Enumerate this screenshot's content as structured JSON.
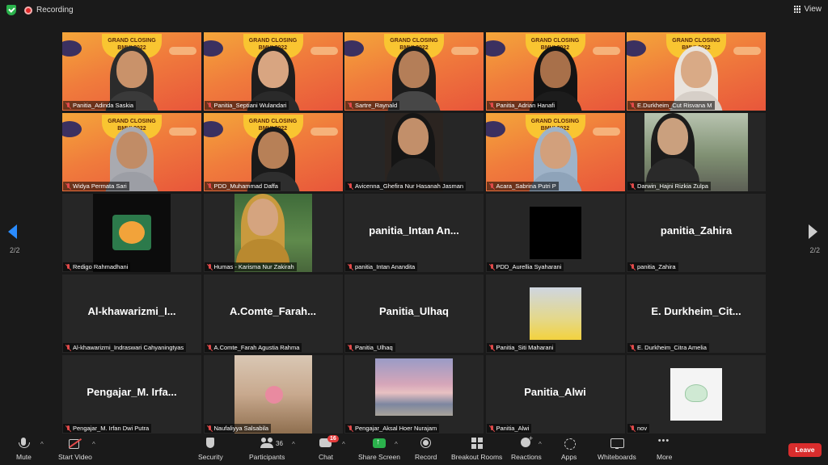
{
  "topbar": {
    "recording_label": "Recording",
    "view_label": "View"
  },
  "pagination": {
    "left": "2/2",
    "right": "2/2"
  },
  "participants": [
    {
      "name": "Panitia_Adinda Saskia",
      "display": "",
      "type": "video",
      "skin": "#c9926a",
      "hijab": "#2b2b2b",
      "body": "#3a3a3a"
    },
    {
      "name": "Panitia_Septiani Wulandari",
      "display": "",
      "type": "video",
      "skin": "#d8a581",
      "hijab": "#1e1e1e",
      "body": "#2a2a2a"
    },
    {
      "name": "Sartre_Raynald",
      "display": "",
      "type": "video",
      "skin": "#b47e58",
      "hijab": "#1b1b1b",
      "body": "#474747"
    },
    {
      "name": "Panitia_Adrian Hanafi",
      "display": "",
      "type": "video",
      "skin": "#a8704a",
      "hijab": "#141414",
      "body": "#1c1c1c"
    },
    {
      "name": "E.Durkheim_Cut Risvana M",
      "display": "",
      "type": "video",
      "skin": "#d9aa86",
      "hijab": "#e9e4de",
      "body": "#d6cfc8"
    },
    {
      "name": "Widya Permata Sari",
      "display": "",
      "type": "video",
      "skin": "#c18c66",
      "hijab": "#a9aab0",
      "body": "#9c9ea5"
    },
    {
      "name": "PDD_Muhammad Daffa",
      "display": "",
      "type": "video",
      "skin": "#b78057",
      "hijab": "#1a1a1a",
      "body": "#2e2e2e"
    },
    {
      "name": "Avicenna_Ghefira Nur Hasanah Jasman",
      "display": "",
      "type": "cam-dark",
      "skin": "#c28f6a",
      "hijab": "#151515",
      "body": "#222"
    },
    {
      "name": "Acara_Sabrina Putri P",
      "display": "",
      "type": "video",
      "skin": "#d2a07c",
      "hijab": "#9fb3c8",
      "body": "#8ea3b9"
    },
    {
      "name": "Darwin_Hajni Rizkia Zulpa",
      "display": "",
      "type": "cam-outdoor",
      "skin": "#caa07e",
      "hijab": "#1c1c1c",
      "body": "#2a2a2a"
    },
    {
      "name": "Redigo Rahmadhani",
      "display": "",
      "type": "image-tiger",
      "skin": "",
      "hijab": "",
      "body": ""
    },
    {
      "name": "Humas - Karisma Nur Zakirah",
      "display": "",
      "type": "image-photo",
      "skin": "#d5a47f",
      "hijab": "#c99a3e",
      "body": "#b9892f"
    },
    {
      "name": "panitia_Intan Anandita",
      "display": "panitia_Intan  An...",
      "type": "text",
      "skin": "",
      "hijab": "",
      "body": ""
    },
    {
      "name": "PDD_Aurellia Syaharani",
      "display": "",
      "type": "image-black",
      "skin": "",
      "hijab": "",
      "body": ""
    },
    {
      "name": "panitia_Zahira",
      "display": "panitia_Zahira",
      "type": "text",
      "skin": "",
      "hijab": "",
      "body": ""
    },
    {
      "name": "Al-khawarizmi_Indraswari Cahyaningtyas",
      "display": "Al-khawarizmi_I...",
      "type": "text",
      "skin": "",
      "hijab": "",
      "body": ""
    },
    {
      "name": "A.Comte_Farah Agustia Rahma",
      "display": "A.Comte_Farah...",
      "type": "text",
      "skin": "",
      "hijab": "",
      "body": ""
    },
    {
      "name": "Panitia_Ulhaq",
      "display": "Panitia_Ulhaq",
      "type": "text",
      "skin": "",
      "hijab": "",
      "body": ""
    },
    {
      "name": "Panitia_Siti Maharani",
      "display": "",
      "type": "image-minion",
      "skin": "",
      "hijab": "",
      "body": ""
    },
    {
      "name": "E. Durkheim_Citra Amelia",
      "display": "E.  Durkheim_Cit...",
      "type": "text",
      "skin": "",
      "hijab": "",
      "body": ""
    },
    {
      "name": "Pengajar_M. Irfan Dwi Putra",
      "display": "Pengajar_M.  Irfa...",
      "type": "text",
      "skin": "",
      "hijab": "",
      "body": ""
    },
    {
      "name": "Naufaliyya Salsabila",
      "display": "",
      "type": "image-flowers",
      "skin": "",
      "hijab": "",
      "body": ""
    },
    {
      "name": "Pengajar_Aksal Hoer Nurajam",
      "display": "",
      "type": "image-beach",
      "skin": "",
      "hijab": "",
      "body": ""
    },
    {
      "name": "Panitia_Alwi",
      "display": "Panitia_Alwi",
      "type": "text",
      "skin": "",
      "hijab": "",
      "body": ""
    },
    {
      "name": "nov",
      "display": "",
      "type": "image-dino",
      "skin": "",
      "hijab": "",
      "body": ""
    }
  ],
  "banner_text": "GRAND CLOSING\nBMUI 2022",
  "toolbar": {
    "mute": "Mute",
    "start_video": "Start Video",
    "security": "Security",
    "participants": "Participants",
    "participants_count": "36",
    "chat": "Chat",
    "chat_badge": "16",
    "share_screen": "Share Screen",
    "record": "Record",
    "breakout_rooms": "Breakout Rooms",
    "reactions": "Reactions",
    "apps": "Apps",
    "whiteboards": "Whiteboards",
    "more": "More",
    "leave": "Leave"
  },
  "colors": {
    "share_green": "#2bb24c",
    "leave_red": "#d92d2d",
    "nav_blue": "#2a8cff"
  }
}
